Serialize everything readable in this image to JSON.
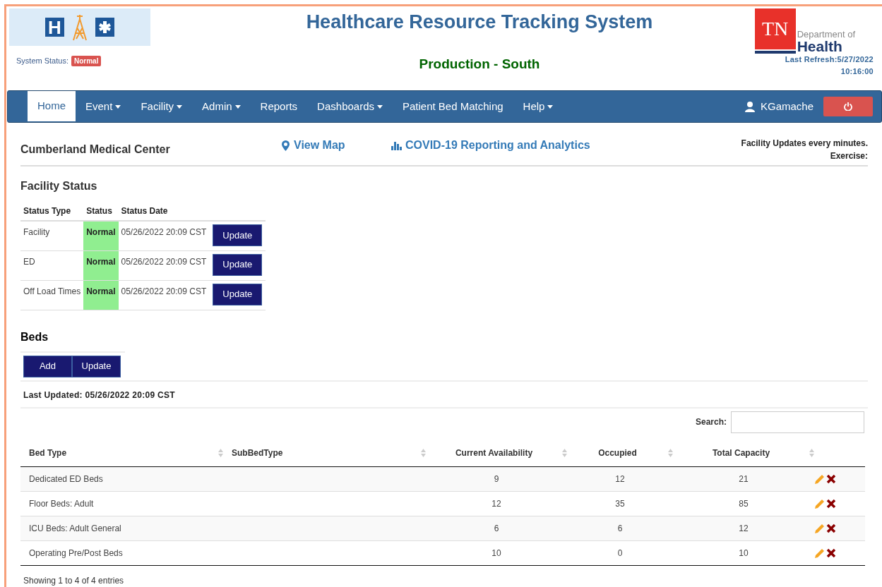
{
  "header": {
    "logo_letter": "H",
    "system_status_label": "System Status:",
    "system_status": "Normal",
    "title": "Healthcare Resource Tracking System",
    "environment": "Production - South",
    "dept_logo": {
      "initials": "TN",
      "line1": "Department of",
      "line2": "Health"
    },
    "last_refresh": "Last Refresh:5/27/2022",
    "last_refresh_time": "10:16:00"
  },
  "nav": {
    "items": [
      {
        "label": "Home",
        "dropdown": false,
        "selected": true
      },
      {
        "label": "Event",
        "dropdown": true,
        "selected": false
      },
      {
        "label": "Facility",
        "dropdown": true,
        "selected": false
      },
      {
        "label": "Admin",
        "dropdown": true,
        "selected": false
      },
      {
        "label": "Reports",
        "dropdown": false,
        "selected": false
      },
      {
        "label": "Dashboards",
        "dropdown": true,
        "selected": false
      },
      {
        "label": "Patient Bed Matching",
        "dropdown": false,
        "selected": false
      },
      {
        "label": "Help",
        "dropdown": true,
        "selected": false
      }
    ],
    "user": "KGamache"
  },
  "facility": {
    "name": "Cumberland Medical Center",
    "view_map": "View Map",
    "covid_link": "COVID-19 Reporting and Analytics",
    "updates_note": "Facility Updates every minutes.",
    "exercise": "Exercise:"
  },
  "facility_status": {
    "title": "Facility Status",
    "columns": [
      "Status Type",
      "Status",
      "Status Date"
    ],
    "rows": [
      {
        "type": "Facility",
        "status": "Normal",
        "date": "05/26/2022 20:09 CST",
        "button": "Update"
      },
      {
        "type": "ED",
        "status": "Normal",
        "date": "05/26/2022 20:09 CST",
        "button": "Update"
      },
      {
        "type": "Off Load Times",
        "status": "Normal",
        "date": "05/26/2022 20:09 CST",
        "button": "Update"
      }
    ]
  },
  "beds": {
    "title": "Beds",
    "buttons": [
      "Add",
      "Update"
    ],
    "last_updated": "Last Updated: 05/26/2022 20:09 CST",
    "search_label": "Search:",
    "columns": [
      "Bed Type",
      "SubBedType",
      "Current Availability",
      "Occupied",
      "Total Capacity"
    ],
    "rows": [
      {
        "bed_type": "Dedicated ED Beds",
        "sub": "",
        "available": "9",
        "occupied": "12",
        "capacity": "21"
      },
      {
        "bed_type": "Floor Beds: Adult",
        "sub": "",
        "available": "12",
        "occupied": "35",
        "capacity": "85"
      },
      {
        "bed_type": "ICU Beds: Adult General",
        "sub": "",
        "available": "6",
        "occupied": "6",
        "capacity": "12"
      },
      {
        "bed_type": "Operating Pre/Post Beds",
        "sub": "",
        "available": "10",
        "occupied": "0",
        "capacity": "10"
      }
    ],
    "footer": "Showing 1 to 4 of 4 entries"
  }
}
